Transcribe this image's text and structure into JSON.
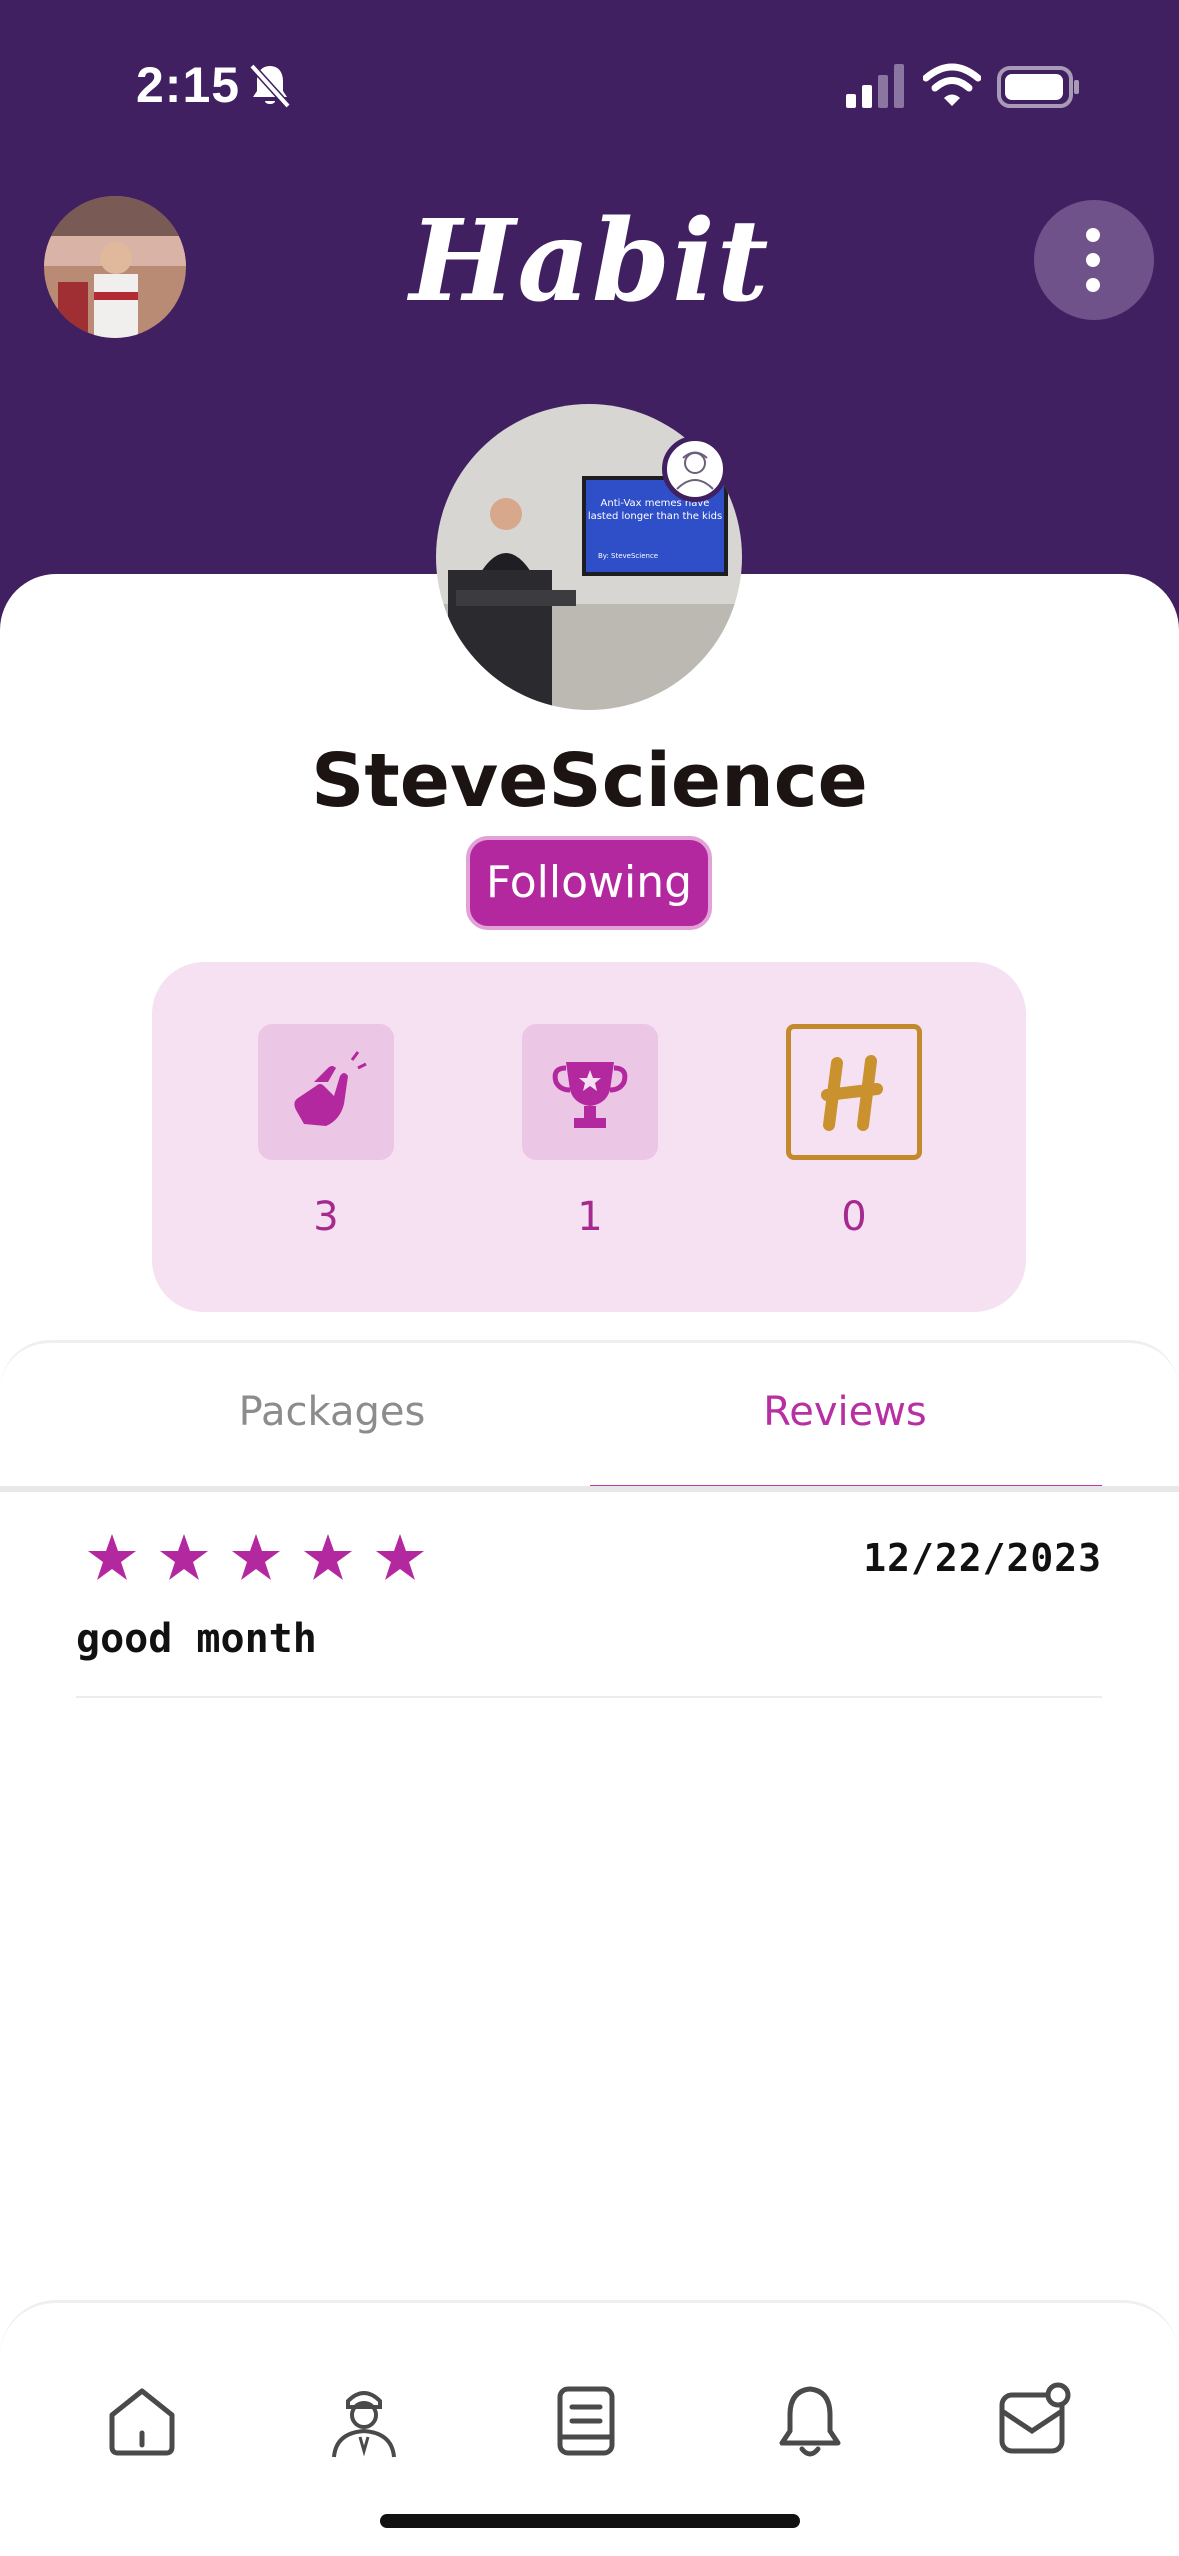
{
  "status_bar": {
    "time": "2:15"
  },
  "header": {
    "brand": "Habit"
  },
  "profile": {
    "username": "SteveScience",
    "follow_label": "Following"
  },
  "stats": [
    {
      "icon": "clapping-hands-icon",
      "value": "3"
    },
    {
      "icon": "trophy-icon",
      "value": "1"
    },
    {
      "icon": "habit-h-logo-icon",
      "value": "0"
    }
  ],
  "tabs": {
    "packages": "Packages",
    "reviews": "Reviews",
    "active": "reviews"
  },
  "reviews": [
    {
      "rating": 5,
      "date": "12/22/2023",
      "text": "good month"
    }
  ],
  "photo_caption": {
    "line1": "Anti-Vax memes have",
    "line2": "lasted longer than the kids",
    "byline": "By: SteveScience"
  },
  "colors": {
    "header_bg": "#412062",
    "accent": "#b3289e",
    "stats_panel": "#f6e1f3",
    "tile": "#ecc6e5",
    "gold": "#c28a2c"
  },
  "bottom_nav": [
    {
      "name": "home-icon"
    },
    {
      "name": "coach-icon"
    },
    {
      "name": "book-icon"
    },
    {
      "name": "bell-icon"
    },
    {
      "name": "inbox-icon"
    }
  ]
}
